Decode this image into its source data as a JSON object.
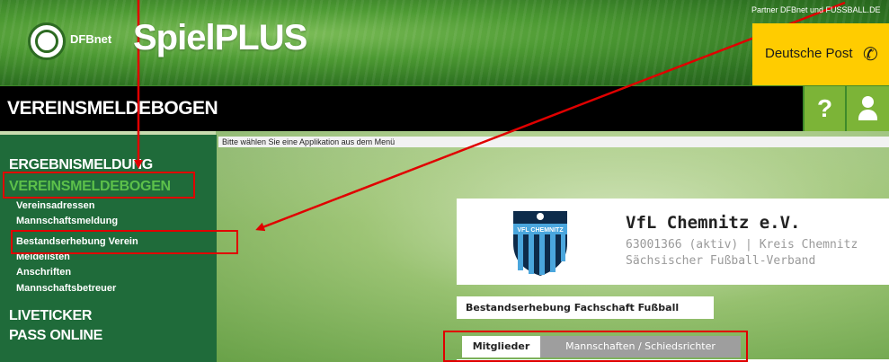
{
  "header": {
    "brand_small": "DFBnet",
    "brand": "SpielPLUS",
    "partner_text": "Partner DFBnet und FUSSBALL.DE",
    "sponsor": "Deutsche Post",
    "sponsor_icon": "post-horn-icon"
  },
  "titlebar": {
    "title": "VEREINSMELDEBOGEN",
    "help_label": "?",
    "user_icon": "user-icon"
  },
  "sidebar": {
    "items": [
      {
        "label": "ERGEBNISMELDUNG",
        "level": 1
      },
      {
        "label": "VEREINSMELDEBOGEN",
        "level": 1,
        "active": true
      },
      {
        "label": "Vereinsadressen",
        "level": 2
      },
      {
        "label": "Mannschaftsmeldung",
        "level": 2
      },
      {
        "label": "Bestandserhebung Verein",
        "level": 2
      },
      {
        "label": "Meldelisten",
        "level": 2
      },
      {
        "label": "Anschriften",
        "level": 2
      },
      {
        "label": "Mannschaftsbetreuer",
        "level": 2
      },
      {
        "label": "LIVETICKER",
        "level": 1
      },
      {
        "label": "PASS ONLINE",
        "level": 1
      }
    ]
  },
  "notice": "Bitte wählen Sie eine Applikation aus dem Menü",
  "club": {
    "crest_text": "VFL CHEMNITZ",
    "name": "VfL Chemnitz e.V.",
    "line1": "63001366 (aktiv) | Kreis Chemnitz",
    "line2": "Sächsischer Fußball-Verband"
  },
  "section_title": "Bestandserhebung Fachschaft Fußball",
  "tabs": {
    "members": "Mitglieder",
    "teams": "Mannschaften / Schiedsrichter"
  },
  "colors": {
    "sidebar_bg": "#1f6b3a",
    "accent_green": "#7cb437",
    "active_nav": "#5cc04a",
    "highlight_red": "#e00000",
    "sponsor_yellow": "#ffcc00"
  }
}
